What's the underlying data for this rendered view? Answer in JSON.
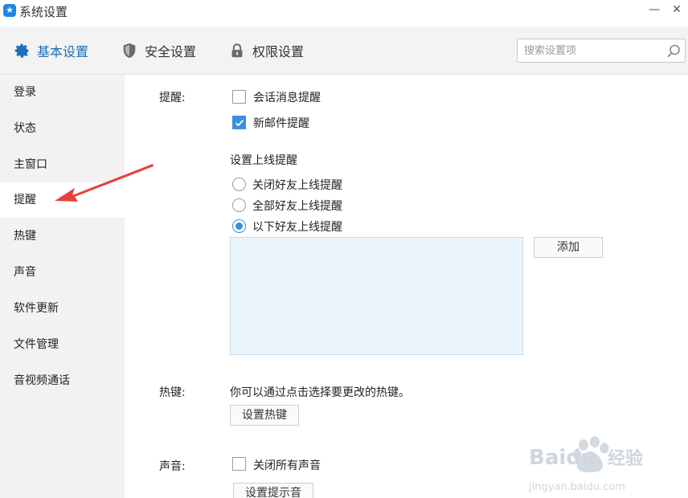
{
  "window": {
    "title": "系统设置",
    "min_symbol": "—",
    "close_symbol": "✕",
    "logo_glyph": "★"
  },
  "toolbar": {
    "tabs": [
      {
        "label": "基本设置",
        "icon": "gear-icon",
        "active": true
      },
      {
        "label": "安全设置",
        "icon": "shield-icon",
        "active": false
      },
      {
        "label": "权限设置",
        "icon": "lock-icon",
        "active": false
      }
    ],
    "search": {
      "placeholder": "搜索设置项",
      "value": ""
    }
  },
  "sidebar": {
    "items": [
      {
        "label": "登录"
      },
      {
        "label": "状态"
      },
      {
        "label": "主窗口"
      },
      {
        "label": "提醒",
        "active": true
      },
      {
        "label": "热键"
      },
      {
        "label": "声音"
      },
      {
        "label": "软件更新"
      },
      {
        "label": "文件管理"
      },
      {
        "label": "音视频通话"
      }
    ]
  },
  "reminder": {
    "label": "提醒:",
    "session_msg": {
      "label": "会话消息提醒",
      "checked": false
    },
    "new_mail": {
      "label": "新邮件提醒",
      "checked": true
    },
    "online_title": "设置上线提醒",
    "online_options": [
      {
        "label": "关闭好友上线提醒",
        "selected": false
      },
      {
        "label": "全部好友上线提醒",
        "selected": false
      },
      {
        "label": "以下好友上线提醒",
        "selected": true
      }
    ],
    "add_button": "添加"
  },
  "hotkey": {
    "label": "热键:",
    "desc": "你可以通过点击选择要更改的热键。",
    "button": "设置热键"
  },
  "sound": {
    "label": "声音:",
    "mute_all": {
      "label": "关闭所有声音",
      "checked": false
    },
    "button": "设置提示音"
  },
  "colors": {
    "accent": "#1c6fb8",
    "check": "#3b8de0",
    "arrow": "#e8403a",
    "list_bg": "#eaf5fb"
  },
  "watermark": {
    "brand": "Baidu",
    "brand_cn": "经验",
    "url": "jingyan.baidu.com"
  }
}
